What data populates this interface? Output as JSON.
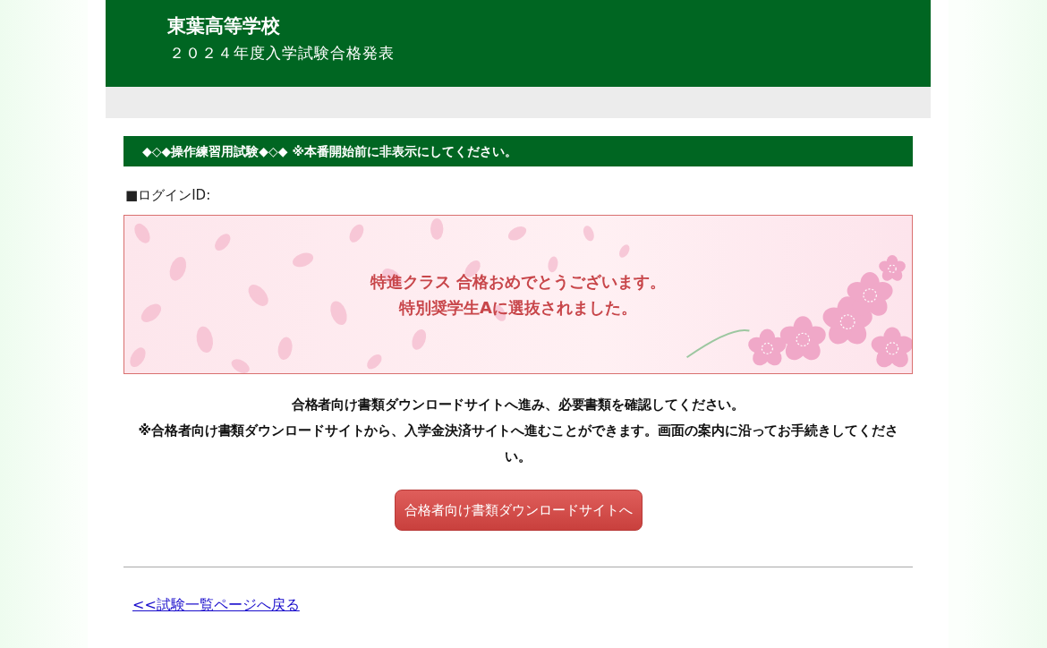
{
  "header": {
    "school_name": "東葉高等学校",
    "subtitle": "２０２４年度入学試験合格発表"
  },
  "notice": "◆◇◆操作練習用試験◆◇◆ ※本番開始前に非表示にしてください。",
  "login_label": "■ログインID:",
  "result": {
    "lines": [
      "特進クラス 合格おめでとうございます。",
      "特別奨学生Aに選抜されました。"
    ]
  },
  "instructions": [
    "合格者向け書類ダウンロードサイトへ進み、必要書類を確認してください。",
    "※合格者向け書類ダウンロードサイトから、入学金決済サイトへ進むことができます。画面の案内に沿ってお手続きしてください。"
  ],
  "download_button": "合格者向け書類ダウンロードサイトへ",
  "back_link": "<<試験一覧ページへ戻る"
}
